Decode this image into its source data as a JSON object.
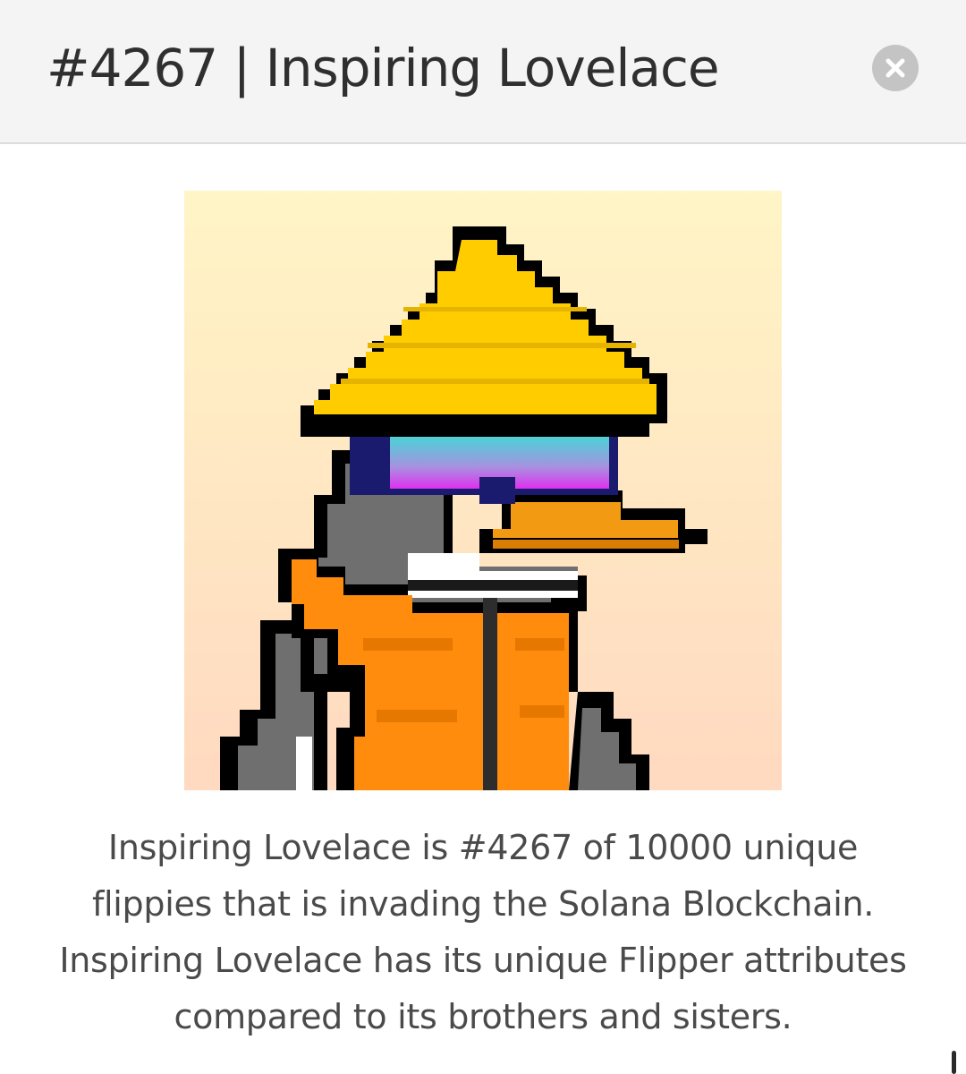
{
  "header": {
    "title": "#4267 | Inspiring Lovelace",
    "close_icon": "close-icon"
  },
  "artwork": {
    "subject": "pixel-art penguin with yellow conical hat, visor goggles and orange vest",
    "background_gradient": [
      "#fff5c6",
      "#ffd9c0"
    ],
    "colors": {
      "hat": "#ffcc00",
      "goggles_top": "#2ef0b0",
      "goggles_bottom": "#e030f0",
      "frame": "#1a1a6e",
      "beak": "#f39a13",
      "vest": "#ff8c0d",
      "feathers": "#6f6f6f",
      "outline": "#000000"
    }
  },
  "description": {
    "lines": [
      "Inspiring Lovelace is #4267 of 10000 unique",
      "flippies that is invading the Solana Blockchain.",
      "Inspiring Lovelace has its unique Flipper attributes",
      "compared to its brothers and sisters."
    ]
  },
  "colors": {
    "header_bg": "#f4f4f4",
    "title_text": "#2f2f2f",
    "body_text": "#4a4a4a",
    "close_button": "#c4c4c4"
  }
}
